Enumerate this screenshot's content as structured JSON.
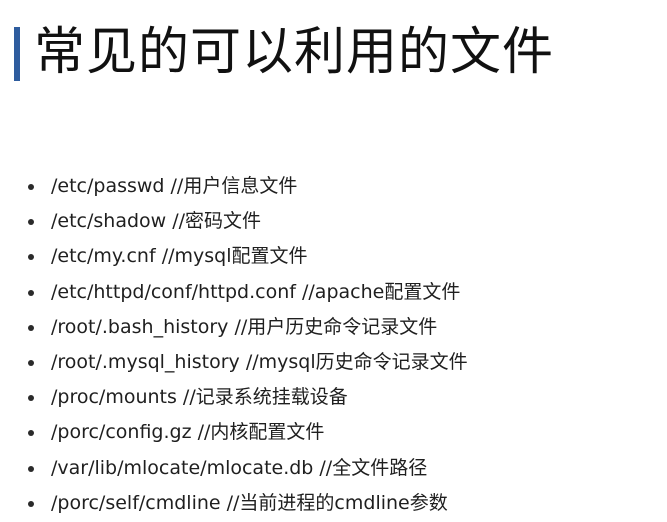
{
  "title": "常见的可以利用的文件",
  "items": [
    "/etc/passwd //用户信息文件",
    "/etc/shadow //密码文件",
    "/etc/my.cnf //mysql配置文件",
    "/etc/httpd/conf/httpd.conf //apache配置文件",
    "/root/.bash_history //用户历史命令记录文件",
    "/root/.mysql_history //mysql历史命令记录文件",
    "/proc/mounts //记录系统挂载设备",
    "/porc/config.gz //内核配置文件",
    "/var/lib/mlocate/mlocate.db //全文件路径",
    "/porc/self/cmdline //当前进程的cmdline参数"
  ],
  "colors": {
    "accent_bar": "#2e5c9e",
    "text": "#1f1f1f",
    "background": "#ffffff"
  }
}
